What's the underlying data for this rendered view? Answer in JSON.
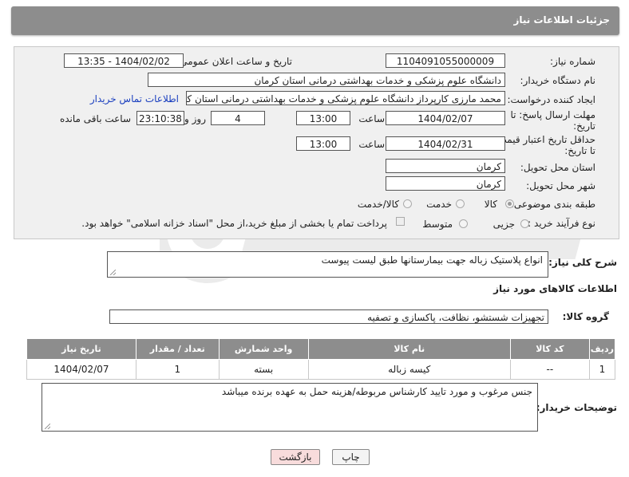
{
  "header": {
    "title": "جزئیات اطلاعات نیاز"
  },
  "form": {
    "need_number_label": "شماره نیاز:",
    "need_number": "1104091055000009",
    "announce_label": "تاریخ و ساعت اعلان عمومی:",
    "announce_value": "1404/02/02 - 13:35",
    "buyer_org_label": "نام دستگاه خریدار:",
    "buyer_org": "دانشگاه علوم پزشکی و خدمات بهداشتی درمانی استان کرمان",
    "creator_label": "ایجاد کننده درخواست:",
    "creator": "محمد مارزی کارپرداز دانشگاه علوم پزشکی و خدمات بهداشتی درمانی استان کرمان",
    "contact_link": "اطلاعات تماس خریدار",
    "reply_deadline_label_1": "مهلت ارسال پاسخ: تا",
    "reply_deadline_label_2": "تاریخ:",
    "reply_date": "1404/02/07",
    "time_label": "ساعت",
    "reply_time": "13:00",
    "days_value": "4",
    "days_label": "روز و",
    "remaining_time": "23:10:38",
    "remaining_label": "ساعت باقی مانده",
    "price_deadline_label_1": "حداقل تاریخ اعتبار قیمت:",
    "price_deadline_label_2": "تا تاریخ:",
    "price_date": "1404/02/31",
    "price_time": "13:00",
    "province_label": "استان محل تحویل:",
    "province": "کرمان",
    "city_label": "شهر محل تحویل:",
    "city": "کرمان",
    "category_label": "طبقه بندی موضوعی:",
    "category_options": [
      "کالا",
      "خدمت",
      "کالا/خدمت"
    ],
    "process_label": "نوع فرآیند خرید :",
    "process_options": [
      "جزیی",
      "متوسط"
    ],
    "payment_note": "پرداخت تمام یا بخشی از مبلغ خرید،از محل \"اسناد خزانه اسلامی\" خواهد بود."
  },
  "description": {
    "label": "شرح کلی نیاز:",
    "value": "انواع پلاستیک زباله جهت بیمارستانها طبق لیست پیوست"
  },
  "goods_section": {
    "title": "اطلاعات کالاهای مورد نیاز",
    "group_label": "گروه کالا:",
    "group_value": "تجهیزات شستشو، نظافت، پاکسازی و تصفیه"
  },
  "table": {
    "headers": [
      "ردیف",
      "کد کالا",
      "نام کالا",
      "واحد شمارش",
      "تعداد / مقدار",
      "تاریخ نیاز"
    ],
    "rows": [
      [
        "1",
        "--",
        "کیسه زباله",
        "بسته",
        "1",
        "1404/02/07"
      ]
    ]
  },
  "buyer_notes": {
    "label": "توضیحات خریدار:",
    "value": "جنس مرغوب و مورد تایید کارشناس مربوطه/هزینه حمل به عهده برنده میباشد"
  },
  "buttons": {
    "print": "چاپ",
    "back": "بازگشت"
  },
  "colors": {
    "header_bg": "#8d8d8d",
    "panel_bg": "#f0f0f0",
    "link": "#1a3fbf",
    "back_btn": "#f8dcdc"
  }
}
